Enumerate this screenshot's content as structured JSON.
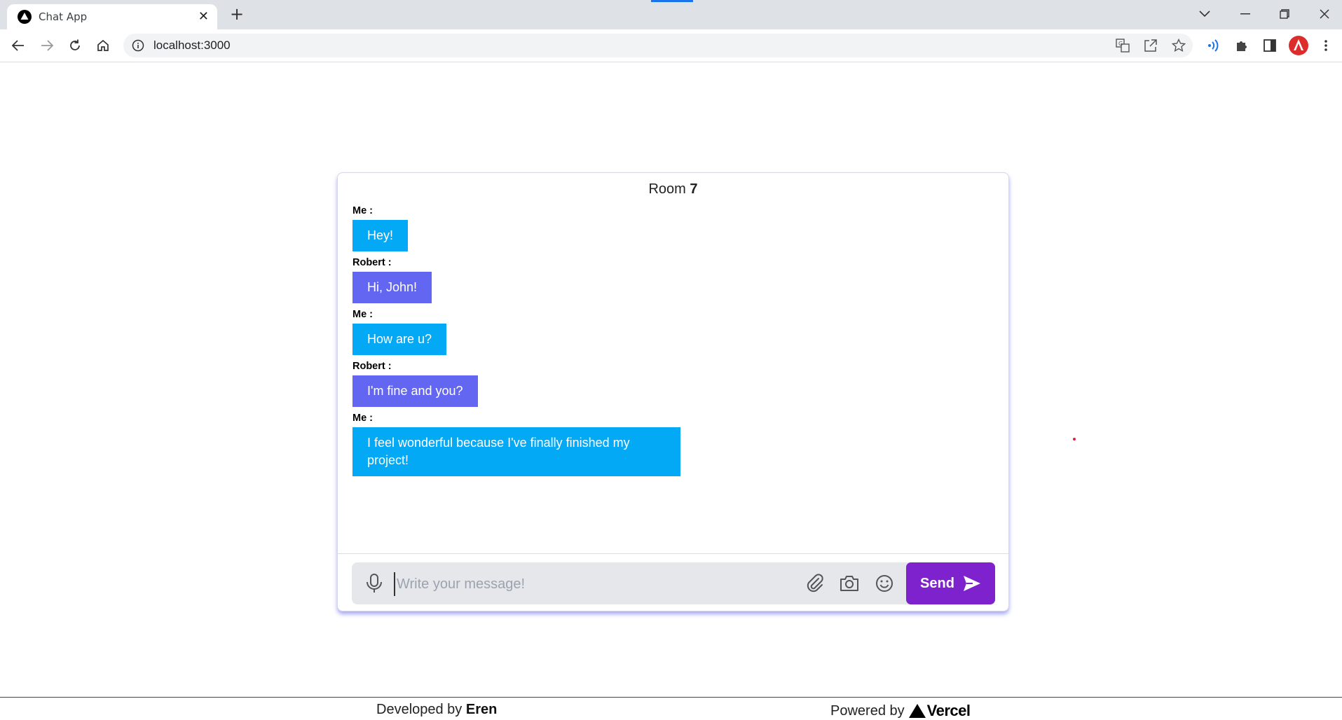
{
  "browser": {
    "tab_title": "Chat App",
    "url": "localhost:3000"
  },
  "chat": {
    "room_label": "Room",
    "room_number": "7",
    "messages": [
      {
        "sender": "Me :",
        "text": "Hey!",
        "from": "me"
      },
      {
        "sender": "Robert :",
        "text": "Hi, John!",
        "from": "other"
      },
      {
        "sender": "Me :",
        "text": "How are u?",
        "from": "me"
      },
      {
        "sender": "Robert :",
        "text": "I'm fine and you?",
        "from": "other"
      },
      {
        "sender": "Me :",
        "text": "I feel wonderful because I've finally finished my project!",
        "from": "me"
      }
    ],
    "input_placeholder": "Write your message!",
    "send_label": "Send"
  },
  "footer": {
    "developed_prefix": "Developed by",
    "developer": "Eren",
    "powered_prefix": "Powered by",
    "powered_brand": "Vercel"
  },
  "colors": {
    "me_bubble": "#03a9f4",
    "other_bubble": "#6366f1",
    "send_button": "#7e22ce"
  },
  "icons": [
    "favicon-icon",
    "close-icon",
    "plus-icon",
    "chevron-down-icon",
    "minimize-icon",
    "restore-icon",
    "back-icon",
    "forward-icon",
    "reload-icon",
    "home-icon",
    "info-icon",
    "translate-icon",
    "share-icon",
    "star-icon",
    "wifi-extension-icon",
    "puzzle-icon",
    "side-panel-icon",
    "profile-icon",
    "menu-icon",
    "microphone-icon",
    "paperclip-icon",
    "camera-icon",
    "emoji-icon",
    "send-arrow-icon",
    "vercel-triangle-icon"
  ]
}
